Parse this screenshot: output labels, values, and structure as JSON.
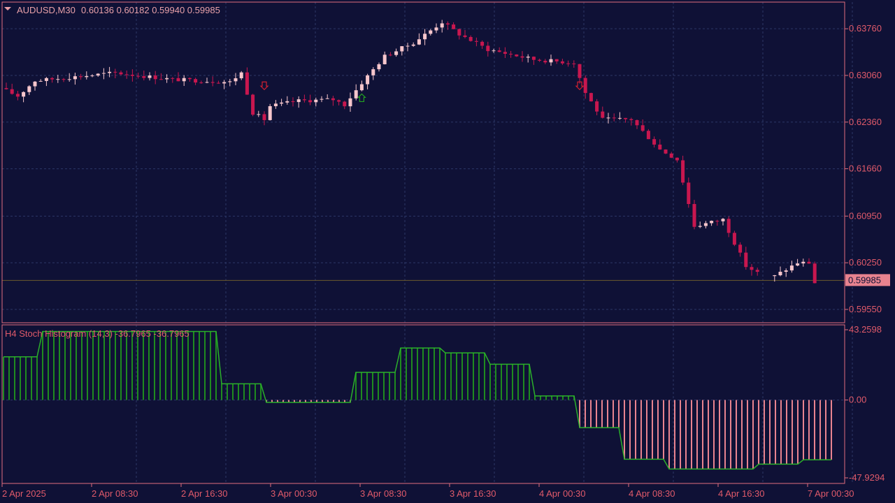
{
  "header": {
    "symbol": "AUDUSD,M30",
    "ohlc": "0.60136 0.60182 0.59940 0.59985"
  },
  "indicator": {
    "label": "H4 Stoch Histogram (14,3) -36.7965 -36.7965"
  },
  "colors": {
    "background": "#0f1136",
    "frame": "#e06d7d",
    "grid": "#2c3766",
    "bull_candle": "#f7c6cc",
    "bear_candle": "#c8174f",
    "hist_positive": "#1f8b1f",
    "hist_positive_line": "#2bb02b",
    "hist_negative": "#e8838f",
    "price_line": "#6b5a2e",
    "price_badge": "#e8838f",
    "buy_arrow": "#22a022",
    "sell_arrow": "#d02030",
    "axis_text": "#e05a6a"
  },
  "chart_data": [
    {
      "type": "candlestick",
      "symbol": "AUDUSD",
      "timeframe": "M30",
      "current_price": 0.59985,
      "current_price_label": "0.59985",
      "ylim": [
        0.5935,
        0.6416
      ],
      "y_ticks": [
        0.6376,
        0.6306,
        0.6236,
        0.6166,
        0.6095,
        0.6025,
        0.5955
      ],
      "y_tick_labels": [
        "0.63760",
        "0.63060",
        "0.62360",
        "0.61660",
        "0.60950",
        "0.60250",
        "0.59550"
      ],
      "x_tick_labels": [
        "2 Apr 2025",
        "2 Apr 08:30",
        "2 Apr 16:30",
        "3 Apr 00:30",
        "3 Apr 08:30",
        "3 Apr 16:30",
        "4 Apr 00:30",
        "4 Apr 08:30",
        "4 Apr 16:30",
        "7 Apr 00:30"
      ],
      "grid": true,
      "signals": [
        {
          "type": "sell",
          "time": "2 Apr 23:00",
          "price": 0.629
        },
        {
          "type": "buy",
          "time": "3 Apr 07:30",
          "price": 0.6273
        },
        {
          "type": "sell",
          "time": "4 Apr 03:00",
          "price": 0.629
        }
      ],
      "candle_count": 142,
      "price_path_waypoints": [
        [
          0,
          0.6287
        ],
        [
          3,
          0.6275
        ],
        [
          6,
          0.6298
        ],
        [
          20,
          0.631
        ],
        [
          30,
          0.63
        ],
        [
          40,
          0.6296
        ],
        [
          42,
          0.631
        ],
        [
          44,
          0.625
        ],
        [
          46,
          0.624
        ],
        [
          47,
          0.626
        ],
        [
          52,
          0.6268
        ],
        [
          58,
          0.627
        ],
        [
          60,
          0.6262
        ],
        [
          63,
          0.6295
        ],
        [
          67,
          0.6335
        ],
        [
          72,
          0.6355
        ],
        [
          77,
          0.6386
        ],
        [
          80,
          0.6368
        ],
        [
          85,
          0.6345
        ],
        [
          93,
          0.633
        ],
        [
          100,
          0.6325
        ],
        [
          102,
          0.628
        ],
        [
          105,
          0.624
        ],
        [
          110,
          0.624
        ],
        [
          115,
          0.6195
        ],
        [
          118,
          0.618
        ],
        [
          121,
          0.608
        ],
        [
          126,
          0.609
        ],
        [
          130,
          0.602
        ],
        [
          134,
          0.6
        ],
        [
          139,
          0.6025
        ],
        [
          141,
          0.6025
        ],
        [
          142,
          0.5995
        ],
        [
          148,
          0.598
        ],
        [
          152,
          0.5998
        ]
      ]
    },
    {
      "type": "bar",
      "name": "H4 Stoch Histogram (14,3)",
      "ylim": [
        -47.9294,
        43.2598
      ],
      "y_tick_labels": [
        "43.2598",
        "0.00",
        "-47.9294"
      ],
      "current_value": -36.7965,
      "segments": [
        {
          "from": 0,
          "to": 6,
          "value": 26.6
        },
        {
          "from": 7,
          "to": 38,
          "value": 42.2
        },
        {
          "from": 39,
          "to": 46,
          "value": 10.0
        },
        {
          "from": 47,
          "to": 62,
          "value": -1.5
        },
        {
          "from": 63,
          "to": 70,
          "value": 17.0
        },
        {
          "from": 71,
          "to": 78,
          "value": 32.0
        },
        {
          "from": 79,
          "to": 86,
          "value": 29.0
        },
        {
          "from": 87,
          "to": 94,
          "value": 22.0
        },
        {
          "from": 95,
          "to": 102,
          "value": 2.5
        },
        {
          "from": 103,
          "to": 110,
          "value": -17.0
        },
        {
          "from": 111,
          "to": 118,
          "value": -36.5
        },
        {
          "from": 119,
          "to": 134,
          "value": -42.5
        },
        {
          "from": 135,
          "to": 142,
          "value": -39.5
        },
        {
          "from": 143,
          "to": 148,
          "value": -36.8
        }
      ]
    }
  ]
}
